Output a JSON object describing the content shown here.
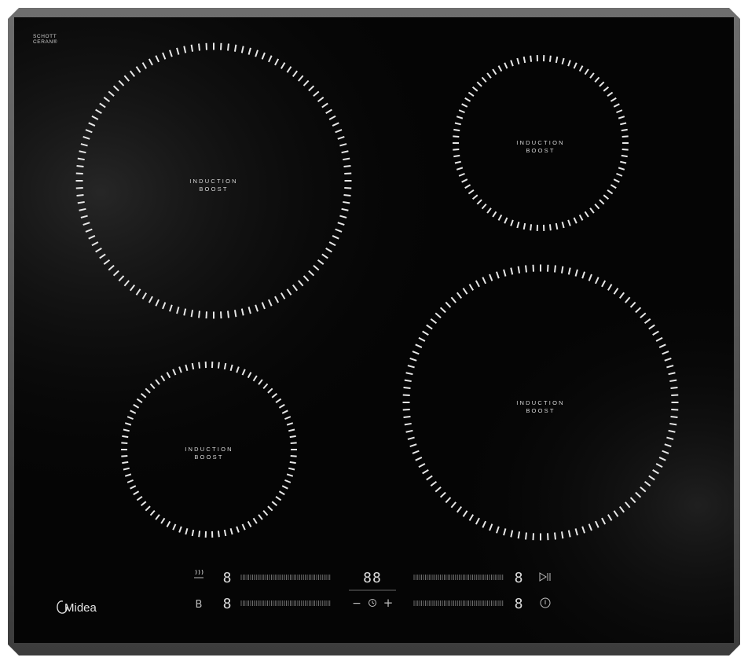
{
  "brand": {
    "glass_line1": "SCHOTT",
    "glass_line2": "CERAN®",
    "logo_text": "Midea"
  },
  "zones": [
    {
      "id": "rear-left",
      "line1": "INDUCTION",
      "line2": "BOOST"
    },
    {
      "id": "rear-right",
      "line1": "INDUCTION",
      "line2": "BOOST"
    },
    {
      "id": "front-left",
      "line1": "INDUCTION",
      "line2": "BOOST"
    },
    {
      "id": "front-right",
      "line1": "INDUCTION",
      "line2": "BOOST"
    }
  ],
  "controls": {
    "left_top_digit": "8",
    "left_bottom_digit": "8",
    "right_top_digit": "8",
    "right_bottom_digit": "8",
    "timer_display": "88",
    "boost_symbol": "B",
    "minus_symbol": "−",
    "plus_symbol": "+",
    "icons": [
      "keep-warm-icon",
      "pause-play-icon",
      "timer-icon",
      "power-icon"
    ]
  },
  "colors": {
    "glass": "#050505",
    "frame": "#5a5a5a",
    "marks": "#e8e8e8"
  }
}
